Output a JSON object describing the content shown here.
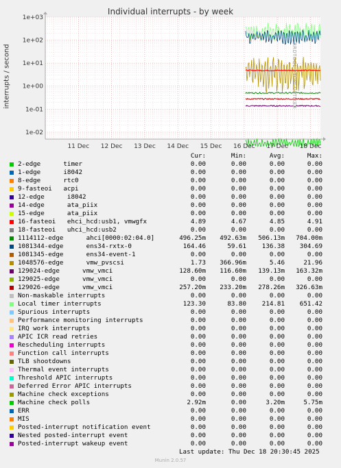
{
  "title": "Individual interrupts - by week",
  "ylabel": "interrupts / second",
  "watermark": "RRDTOOL / TOBI OETIKER",
  "legend_headers": [
    "Cur:",
    "Min:",
    "Avg:",
    "Max:"
  ],
  "legend": [
    {
      "name": "2-edge      timer",
      "cur": "0.00",
      "min": "0.00",
      "avg": "0.00",
      "max": "0.00",
      "color": "#00cc00"
    },
    {
      "name": "1-edge      i8042",
      "cur": "0.00",
      "min": "0.00",
      "avg": "0.00",
      "max": "0.00",
      "color": "#0066b3"
    },
    {
      "name": "8-edge      rtc0",
      "cur": "0.00",
      "min": "0.00",
      "avg": "0.00",
      "max": "0.00",
      "color": "#ff8000"
    },
    {
      "name": "9-fasteoi   acpi",
      "cur": "0.00",
      "min": "0.00",
      "avg": "0.00",
      "max": "0.00",
      "color": "#ffcc00"
    },
    {
      "name": "12-edge      i8042",
      "cur": "0.00",
      "min": "0.00",
      "avg": "0.00",
      "max": "0.00",
      "color": "#330099"
    },
    {
      "name": "14-edge      ata_piix",
      "cur": "0.00",
      "min": "0.00",
      "avg": "0.00",
      "max": "0.00",
      "color": "#990099"
    },
    {
      "name": "15-edge      ata_piix",
      "cur": "0.00",
      "min": "0.00",
      "avg": "0.00",
      "max": "0.00",
      "color": "#ccff00"
    },
    {
      "name": "16-fasteoi   ehci_hcd:usb1, vmwgfx",
      "cur": "4.89",
      "min": "4.67",
      "avg": "4.85",
      "max": "4.91",
      "color": "#ff0000"
    },
    {
      "name": "18-fasteoi   uhci_hcd:usb2",
      "cur": "0.00",
      "min": "0.00",
      "avg": "0.00",
      "max": "0.00",
      "color": "#808080"
    },
    {
      "name": "1114112-edge      ahci[0000:02:04.0]",
      "cur": "496.25m",
      "min": "492.63m",
      "avg": "506.13m",
      "max": "704.00m",
      "color": "#008f00"
    },
    {
      "name": "1081344-edge      ens34-rxtx-0",
      "cur": "164.46",
      "min": "59.61",
      "avg": "136.38",
      "max": "304.69",
      "color": "#00487d"
    },
    {
      "name": "1081345-edge      ens34-event-1",
      "cur": "0.00",
      "min": "0.00",
      "avg": "0.00",
      "max": "0.00",
      "color": "#b35a00"
    },
    {
      "name": "1048576-edge      vmw_pvscsi",
      "cur": "1.73",
      "min": "366.96m",
      "avg": "5.46",
      "max": "21.96",
      "color": "#b38f00"
    },
    {
      "name": "129024-edge      vmw_vmci",
      "cur": "128.60m",
      "min": "116.60m",
      "avg": "139.13m",
      "max": "163.32m",
      "color": "#6b006b"
    },
    {
      "name": "129025-edge      vmw_vmci",
      "cur": "0.00",
      "min": "0.00",
      "avg": "0.00",
      "max": "0.00",
      "color": "#8fb300"
    },
    {
      "name": "129026-edge      vmw_vmci",
      "cur": "257.20m",
      "min": "233.20m",
      "avg": "278.26m",
      "max": "326.63m",
      "color": "#b30000"
    },
    {
      "name": "Non-maskable interrupts",
      "cur": "0.00",
      "min": "0.00",
      "avg": "0.00",
      "max": "0.00",
      "color": "#bebebe"
    },
    {
      "name": "Local timer interrupts",
      "cur": "123.30",
      "min": "83.80",
      "avg": "214.81",
      "max": "651.42",
      "color": "#80ff80"
    },
    {
      "name": "Spurious interrupts",
      "cur": "0.00",
      "min": "0.00",
      "avg": "0.00",
      "max": "0.00",
      "color": "#80c9ff"
    },
    {
      "name": "Performance monitoring interrupts",
      "cur": "0.00",
      "min": "0.00",
      "avg": "0.00",
      "max": "0.00",
      "color": "#ffc080"
    },
    {
      "name": "IRQ work interrupts",
      "cur": "0.00",
      "min": "0.00",
      "avg": "0.00",
      "max": "0.00",
      "color": "#ffe680"
    },
    {
      "name": "APIC ICR read retries",
      "cur": "0.00",
      "min": "0.00",
      "avg": "0.00",
      "max": "0.00",
      "color": "#aa80ff"
    },
    {
      "name": "Rescheduling interrupts",
      "cur": "0.00",
      "min": "0.00",
      "avg": "0.00",
      "max": "0.00",
      "color": "#ee00cc"
    },
    {
      "name": "Function call interrupts",
      "cur": "0.00",
      "min": "0.00",
      "avg": "0.00",
      "max": "0.00",
      "color": "#ff8080"
    },
    {
      "name": "TLB shootdowns",
      "cur": "0.00",
      "min": "0.00",
      "avg": "0.00",
      "max": "0.00",
      "color": "#666600"
    },
    {
      "name": "Thermal event interrupts",
      "cur": "0.00",
      "min": "0.00",
      "avg": "0.00",
      "max": "0.00",
      "color": "#ffbfff"
    },
    {
      "name": "Threshold APIC interrupts",
      "cur": "0.00",
      "min": "0.00",
      "avg": "0.00",
      "max": "0.00",
      "color": "#00ffcc"
    },
    {
      "name": "Deferred Error APIC interrupts",
      "cur": "0.00",
      "min": "0.00",
      "avg": "0.00",
      "max": "0.00",
      "color": "#cc6699"
    },
    {
      "name": "Machine check exceptions",
      "cur": "0.00",
      "min": "0.00",
      "avg": "0.00",
      "max": "0.00",
      "color": "#999900"
    },
    {
      "name": "Machine check polls",
      "cur": "2.92m",
      "min": "0.00",
      "avg": "3.20m",
      "max": "5.75m",
      "color": "#00cc00"
    },
    {
      "name": "ERR",
      "cur": "0.00",
      "min": "0.00",
      "avg": "0.00",
      "max": "0.00",
      "color": "#0066b3"
    },
    {
      "name": "MIS",
      "cur": "0.00",
      "min": "0.00",
      "avg": "0.00",
      "max": "0.00",
      "color": "#ff8000"
    },
    {
      "name": "Posted-interrupt notification event",
      "cur": "0.00",
      "min": "0.00",
      "avg": "0.00",
      "max": "0.00",
      "color": "#ffcc00"
    },
    {
      "name": "Nested posted-interrupt event",
      "cur": "0.00",
      "min": "0.00",
      "avg": "0.00",
      "max": "0.00",
      "color": "#330099"
    },
    {
      "name": "Posted-interrupt wakeup event",
      "cur": "0.00",
      "min": "0.00",
      "avg": "0.00",
      "max": "0.00",
      "color": "#990099"
    }
  ],
  "last_update": "Last update: Thu Dec 18 20:30:45 2025",
  "munin_version": "Munin 2.0.57",
  "chart_data": {
    "type": "line",
    "title": "Individual interrupts - by week",
    "ylabel": "interrupts / second",
    "yscale": "log",
    "ylim": [
      0.005,
      1000
    ],
    "y_ticks": [
      "1e-02",
      "1e-01",
      "1e+00",
      "1e+01",
      "1e+02",
      "1e+03"
    ],
    "x_ticks": [
      "11 Dec",
      "12 Dec",
      "13 Dec",
      "14 Dec",
      "15 Dec",
      "16 Dec",
      "17 Dec",
      "18 Dec"
    ],
    "data_start": "16 Dec",
    "grid": true,
    "series": [
      {
        "name": "Local timer interrupts",
        "color": "#80ff80",
        "min": 83.8,
        "avg": 214.81,
        "max": 651.42,
        "cur": 123.3
      },
      {
        "name": "1081344-edge      ens34-rxtx-0",
        "color": "#00487d",
        "min": 59.61,
        "avg": 136.38,
        "max": 304.69,
        "cur": 164.46
      },
      {
        "name": "1048576-edge      vmw_pvscsi",
        "color": "#b38f00",
        "min": 0.36696,
        "avg": 5.46,
        "max": 21.96,
        "cur": 1.73
      },
      {
        "name": "16-fasteoi   ehci_hcd:usb1, vmwgfx",
        "color": "#ff0000",
        "min": 4.67,
        "avg": 4.85,
        "max": 4.91,
        "cur": 4.89
      },
      {
        "name": "1114112-edge      ahci[0000:02:04.0]",
        "color": "#008f00",
        "min": 0.49263,
        "avg": 0.50613,
        "max": 0.704,
        "cur": 0.49625
      },
      {
        "name": "129026-edge      vmw_vmci",
        "color": "#b30000",
        "min": 0.2332,
        "avg": 0.27826,
        "max": 0.32663,
        "cur": 0.2572
      },
      {
        "name": "129024-edge      vmw_vmci",
        "color": "#6b006b",
        "min": 0.1166,
        "avg": 0.13913,
        "max": 0.16332,
        "cur": 0.1286
      },
      {
        "name": "Machine check polls",
        "color": "#00cc00",
        "min": 0,
        "avg": 0.0032,
        "max": 0.00575,
        "cur": 0.00292
      }
    ]
  }
}
